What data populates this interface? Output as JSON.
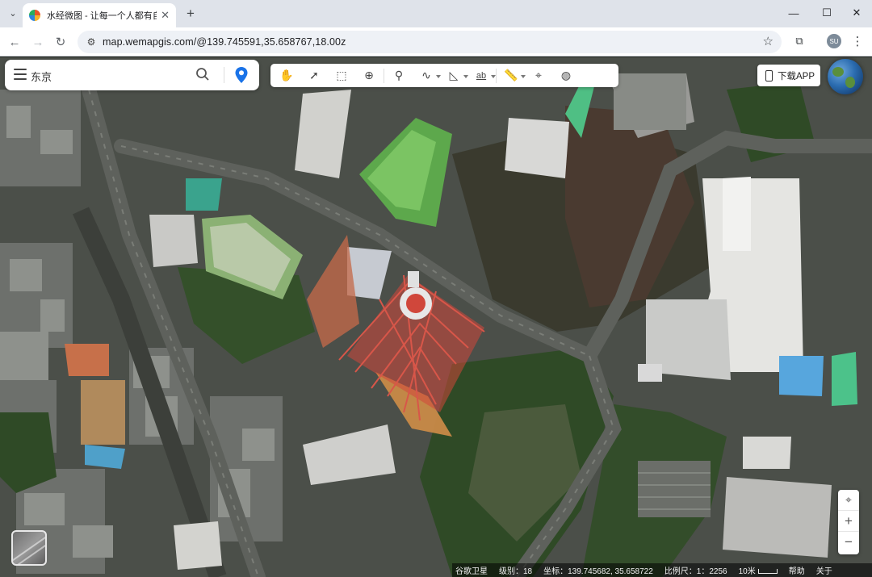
{
  "browser": {
    "tab": {
      "title": "水经微图 - 让每一个人都有自己",
      "favicon": "earth-favicon-icon"
    },
    "address_bar": {
      "url": "map.wemapgis.com/@139.745591,35.658767,18.00z"
    }
  },
  "search": {
    "query": "东京"
  },
  "toolbar": {
    "text_tool_label": "ab",
    "tools": [
      "hand-pan-icon",
      "select-arrow-icon",
      "box-select-icon",
      "zoom-extent-icon",
      "marker-icon",
      "polyline-icon",
      "polygon-icon",
      "text-label-icon",
      "ruler-icon",
      "measure-area-icon",
      "globe-icon"
    ]
  },
  "download_app": {
    "label": "下载APP"
  },
  "zoom": {
    "plus": "+",
    "minus": "−"
  },
  "status": {
    "source": "谷歌卫星",
    "level": "级别：18",
    "coords": "坐标：139.745682, 35.658722",
    "scale": "比例尺：1：2256",
    "scale_label": "10米",
    "help": "帮助",
    "account": "关于"
  },
  "colors": {
    "accent": "#1a73e8",
    "tower_red": "#d8473b",
    "park_green": "#2f4a26"
  }
}
